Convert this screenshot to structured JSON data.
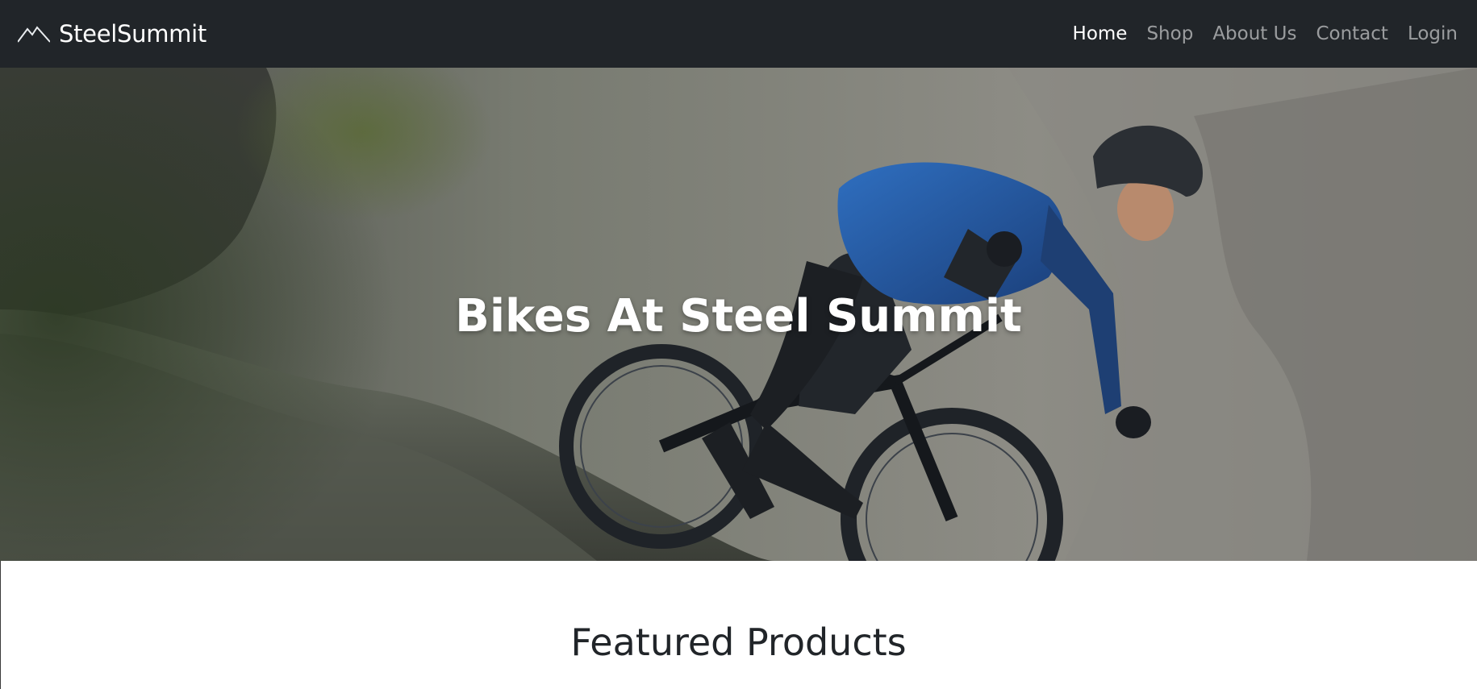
{
  "navbar": {
    "brand_name": "SteelSummit",
    "brand_icon": "mountain-icon",
    "links": [
      {
        "label": "Home",
        "active": true
      },
      {
        "label": "Shop",
        "active": false
      },
      {
        "label": "About Us",
        "active": false
      },
      {
        "label": "Contact",
        "active": false
      },
      {
        "label": "Login",
        "active": false
      }
    ]
  },
  "hero": {
    "title": "Bikes At Steel Summit",
    "image": "mountain-biker-photo"
  },
  "featured": {
    "heading": "Featured Products"
  },
  "colors": {
    "navbar_bg": "#212529",
    "nav_active": "#ffffff",
    "nav_inactive": "rgba(255,255,255,0.55)",
    "heading_text": "#212529"
  }
}
